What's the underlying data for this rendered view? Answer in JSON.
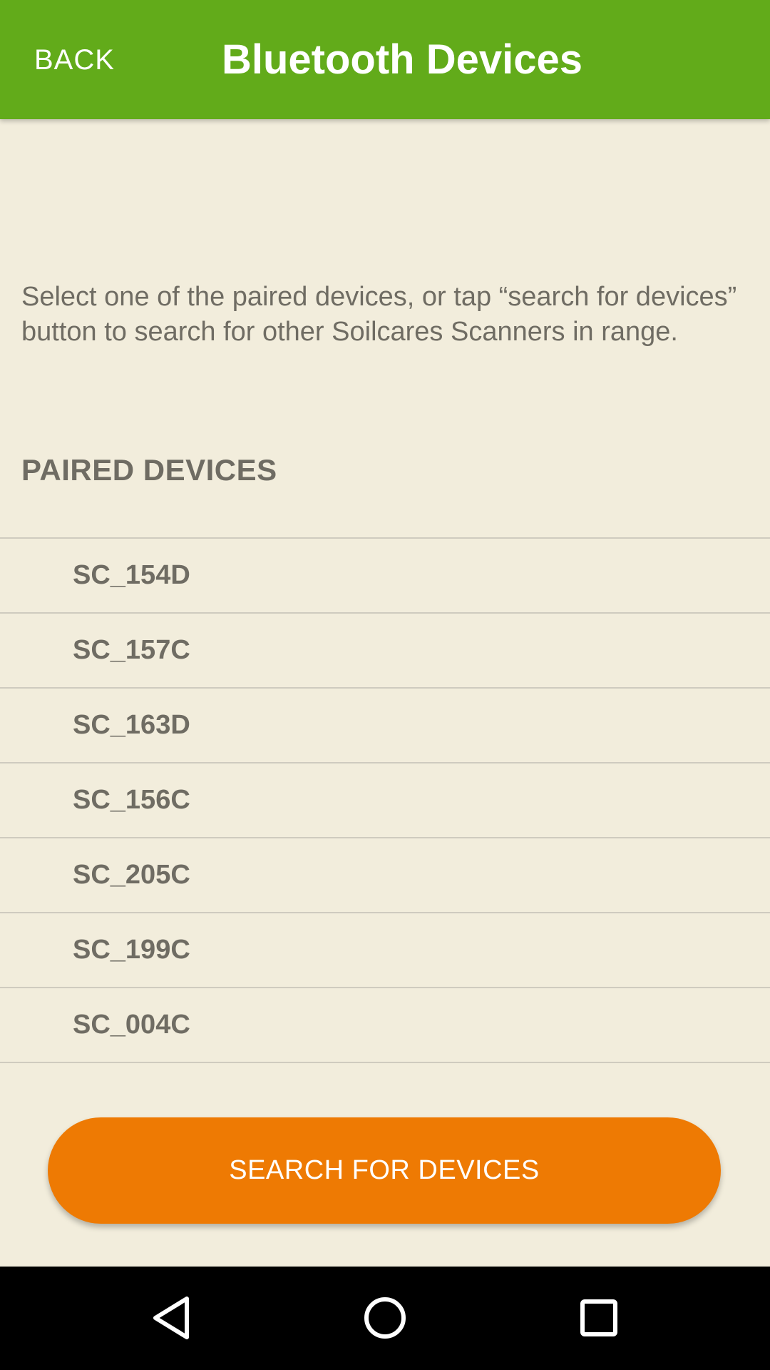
{
  "header": {
    "back_label": "BACK",
    "title": "Bluetooth Devices"
  },
  "instructions": "Select one of the paired devices, or tap “search for devices” button to search for other Soilcares Scanners in range.",
  "paired_section": {
    "header": "PAIRED DEVICES",
    "devices": [
      "SC_154D",
      "SC_157C",
      "SC_163D",
      "SC_156C",
      "SC_205C",
      "SC_199C",
      "SC_004C"
    ]
  },
  "search_button_label": "SEARCH FOR DEVICES",
  "nav_bar": {
    "icons": [
      "back-triangle-icon",
      "home-circle-icon",
      "recents-square-icon"
    ]
  },
  "colors": {
    "app_bar": "#62ab1a",
    "background": "#f2eddc",
    "accent_button": "#ee7a03",
    "text": "#6f6c63",
    "divider": "#cfcbbf"
  }
}
